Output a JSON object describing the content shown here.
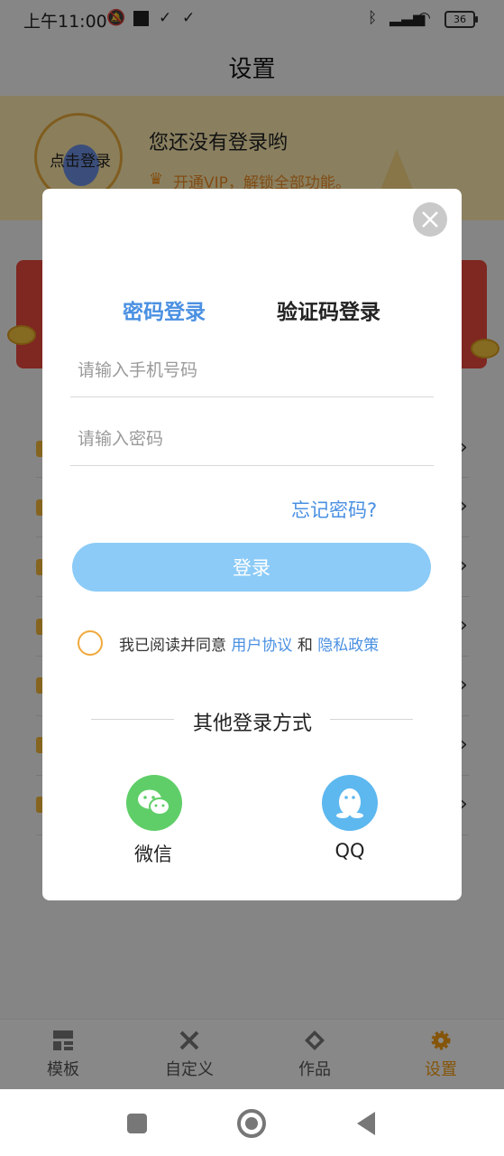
{
  "status_bar": {
    "time": "上午11:00",
    "battery": "36"
  },
  "header": {
    "title": "设置"
  },
  "banner": {
    "avatar_text": "点击登录",
    "title": "您还没有登录哟",
    "vip_text": "开通VIP，解锁全部功能。"
  },
  "dialog": {
    "tabs": [
      "密码登录",
      "验证码登录"
    ],
    "phone_placeholder": "请输入手机号码",
    "password_placeholder": "请输入密码",
    "forgot": "忘记密码?",
    "login_button": "登录",
    "agree_prefix": "我已阅读并同意",
    "user_agreement": "用户协议",
    "and": "和",
    "privacy_policy": "隐私政策",
    "other_title": "其他登录方式",
    "social": [
      "微信",
      "QQ"
    ]
  },
  "tabbar": {
    "items": [
      "模板",
      "自定义",
      "作品",
      "设置"
    ],
    "active": "设置"
  },
  "colors": {
    "accent": "#4a90e2",
    "tab_active": "#f39c12",
    "wechat": "#5fce68",
    "qq": "#5db8ef",
    "login_button": "#8ccbf7"
  }
}
